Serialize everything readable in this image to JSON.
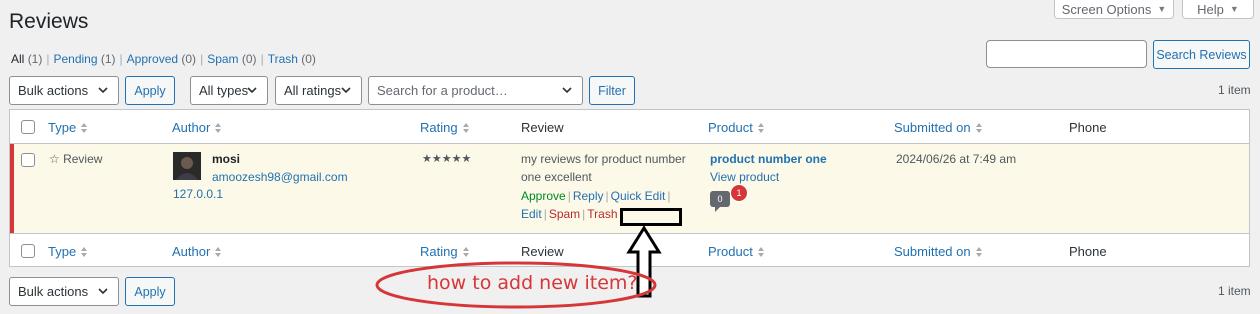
{
  "header": {
    "title": "Reviews",
    "screen_options": "Screen Options",
    "help": "Help"
  },
  "views": [
    {
      "label": "All",
      "count": "(1)"
    },
    {
      "label": "Pending",
      "count": "(1)"
    },
    {
      "label": "Approved",
      "count": "(0)"
    },
    {
      "label": "Spam",
      "count": "(0)"
    },
    {
      "label": "Trash",
      "count": "(0)"
    }
  ],
  "search": {
    "value": "",
    "button": "Search Reviews"
  },
  "top_nav": {
    "bulk_actions": "Bulk actions",
    "apply": "Apply",
    "type_filter": "All types",
    "rating_filter": "All ratings",
    "product_search_placeholder": "Search for a product…",
    "filter": "Filter",
    "items": "1 item"
  },
  "columns": [
    "Type",
    "Author",
    "Rating",
    "Review",
    "Product",
    "Submitted on",
    "Phone"
  ],
  "row": {
    "type": "☆ Review",
    "author_name": "mosi",
    "author_email": "amoozesh98@gmail.com",
    "author_ip": "127.0.0.1",
    "rating_stars": "★★★★★",
    "review_text_line1": "my reviews for product number",
    "review_text_line2": "one excellent",
    "actions": {
      "approve": "Approve",
      "reply": "Reply",
      "quick_edit": "Quick Edit",
      "edit": "Edit",
      "spam": "Spam",
      "trash": "Trash"
    },
    "product_name": "product number one",
    "view_product": "View product",
    "approved_count": "0",
    "pending_count": "1",
    "submitted": "2024/06/26 at 7:49 am",
    "phone": ""
  },
  "bottom_nav": {
    "bulk_actions": "Bulk actions",
    "apply": "Apply",
    "items": "1 item"
  },
  "annotation": {
    "question": "how to add new item?",
    "color": "#d63638"
  }
}
